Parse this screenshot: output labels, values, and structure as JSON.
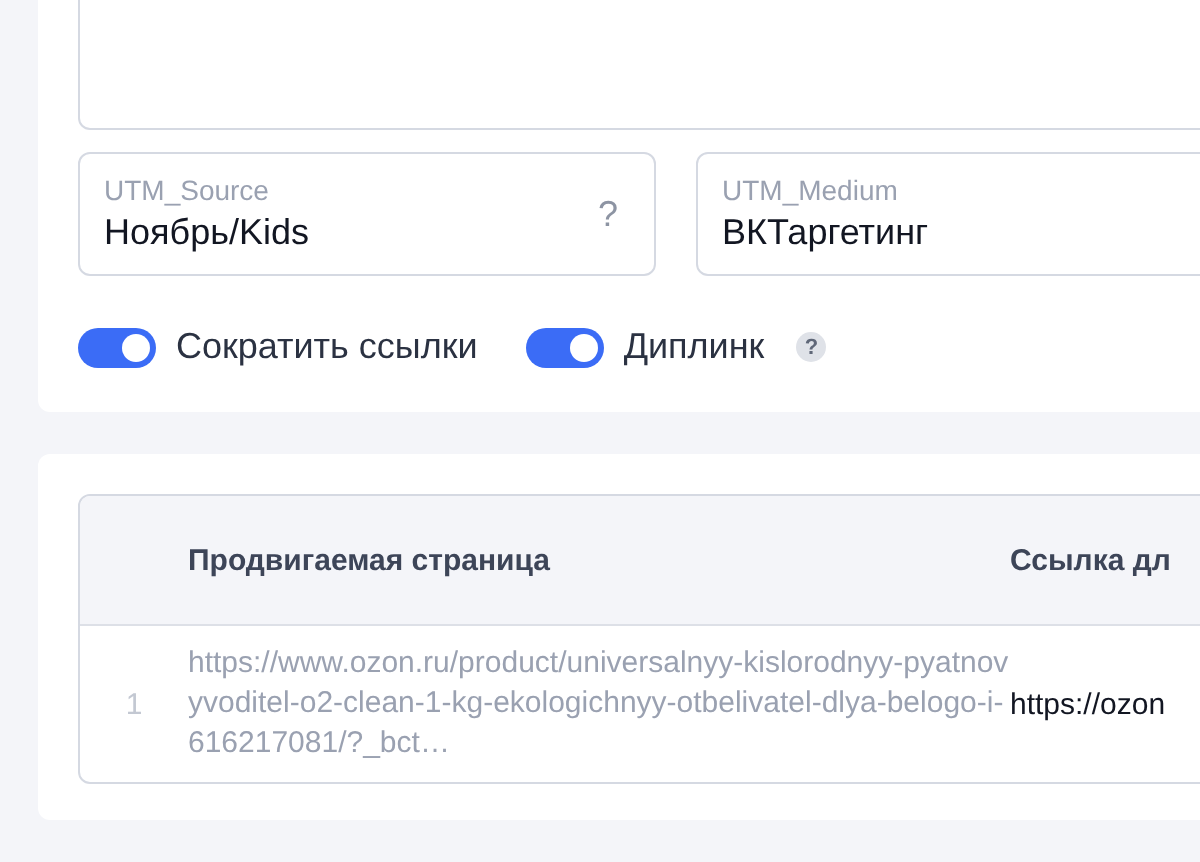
{
  "utm_fields": [
    {
      "label": "UTM_Source",
      "value": "Ноябрь/Kids",
      "help": "?"
    },
    {
      "label": "UTM_Medium",
      "value": "ВКТаргетинг"
    }
  ],
  "toggles": [
    {
      "label": "Сократить ссылки",
      "on": true
    },
    {
      "label": "Диплинк",
      "on": true,
      "help": "?"
    }
  ],
  "table": {
    "columns": [
      "Продвигаемая страница",
      "Ссылка дл"
    ],
    "rows": [
      {
        "index": "1",
        "page": "https://www.ozon.ru/product/universalnyy-kislorodnyy-pyatnovyvoditel-o2-clean-1-kg-ekologichnyy-otbelivatel-dlya-belogo-i-616217081/?_bct…",
        "link": "https://ozon"
      }
    ]
  }
}
